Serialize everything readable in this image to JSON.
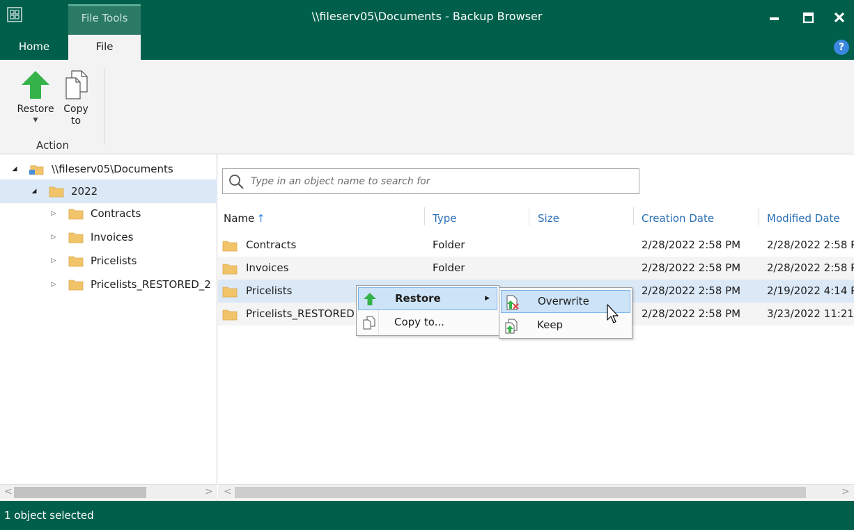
{
  "window": {
    "title": "\\\\fileserv05\\Documents - Backup Browser",
    "contextual_tab": "File Tools"
  },
  "ribbon": {
    "tabs": [
      {
        "label": "Home",
        "active": false
      },
      {
        "label": "File",
        "active": true
      }
    ],
    "help_icon": "?",
    "buttons": {
      "restore": {
        "label": "Restore",
        "icon": "green-up-arrow-icon",
        "has_dropdown": true
      },
      "copy_to": {
        "label": "Copy\nto",
        "label_line1": "Copy",
        "label_line2": "to",
        "icon": "copy-document-icon"
      }
    },
    "group_label": "Action"
  },
  "tree": {
    "items": [
      {
        "label": "\\\\fileserv05\\Documents",
        "level": 0,
        "expanded": true,
        "icon": "share-folder-icon"
      },
      {
        "label": "2022",
        "level": 1,
        "expanded": true,
        "selected": true,
        "icon": "folder-icon"
      },
      {
        "label": "Contracts",
        "level": 2,
        "expanded": false,
        "icon": "folder-icon"
      },
      {
        "label": "Invoices",
        "level": 2,
        "expanded": false,
        "icon": "folder-icon"
      },
      {
        "label": "Pricelists",
        "level": 2,
        "expanded": false,
        "icon": "folder-icon"
      },
      {
        "label": "Pricelists_RESTORED_2",
        "level": 2,
        "expanded": false,
        "icon": "folder-icon"
      }
    ]
  },
  "search": {
    "placeholder": "Type in an object name to search for",
    "value": ""
  },
  "table": {
    "columns": [
      "Name",
      "Type",
      "Size",
      "Creation Date",
      "Modified Date"
    ],
    "sort_column": "Name",
    "rows": [
      {
        "name": "Contracts",
        "type": "Folder",
        "size": "",
        "created": "2/28/2022 2:58 PM",
        "modified": "2/28/2022 2:58 P"
      },
      {
        "name": "Invoices",
        "type": "Folder",
        "size": "",
        "created": "2/28/2022 2:58 PM",
        "modified": "2/28/2022 2:58 P"
      },
      {
        "name": "Pricelists",
        "type": "",
        "size": "",
        "created": "2/28/2022 2:58 PM",
        "modified": "2/19/2022 4:14 P",
        "selected": true
      },
      {
        "name": "Pricelists_RESTORED",
        "type": "",
        "size": "",
        "created": "2/28/2022 2:58 PM",
        "modified": "3/23/2022 11:21"
      }
    ]
  },
  "context_menu": {
    "items": [
      {
        "label": "Restore",
        "icon": "green-up-arrow-icon",
        "has_submenu": true,
        "highlighted": true
      },
      {
        "label": "Copy to...",
        "icon": "copy-document-icon"
      }
    ],
    "submenu": [
      {
        "label": "Overwrite",
        "icon": "overwrite-icon",
        "highlighted": true
      },
      {
        "label": "Keep",
        "icon": "keep-icon"
      }
    ]
  },
  "status": {
    "text": "1 object selected"
  },
  "colors": {
    "titlebar": "#005f4b",
    "selection": "#dbe8f6",
    "accent_green": "#35b34a",
    "column_header_blue": "#2a6fb5"
  }
}
